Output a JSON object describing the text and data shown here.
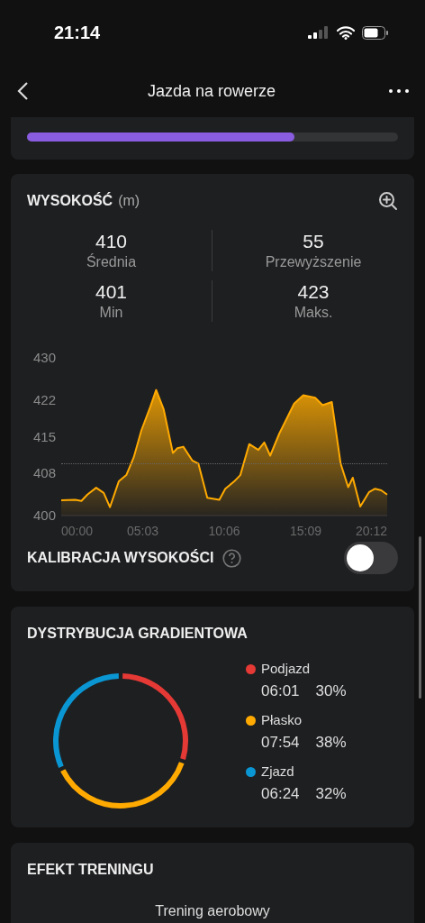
{
  "status_bar": {
    "time": "21:14"
  },
  "nav": {
    "title": "Jazda na rowerze"
  },
  "top_card": {
    "level": 0.72
  },
  "elevation": {
    "title": "WYSOKOŚĆ",
    "unit": "(m)",
    "stats": [
      {
        "value": "410",
        "label": "Średnia"
      },
      {
        "value": "55",
        "label": "Przewyższenie"
      },
      {
        "value": "401",
        "label": "Min"
      },
      {
        "value": "423",
        "label": "Maks."
      }
    ],
    "chart_data": {
      "type": "area",
      "x": [
        0,
        52,
        75,
        97,
        130,
        158,
        181,
        214,
        242,
        270,
        298,
        331,
        353,
        381,
        415,
        432,
        454,
        487,
        510,
        543,
        588,
        610,
        643,
        666,
        699,
        733,
        755,
        777,
        811,
        866,
        900,
        944,
        972,
        1006,
        1039,
        1067,
        1084,
        1112,
        1145,
        1167,
        1190,
        1212
      ],
      "series": [
        {
          "color": "#ffaa00",
          "values": [
            402.9,
            403.0,
            402.8,
            404.0,
            405.3,
            404.3,
            401.6,
            406.5,
            407.7,
            411.1,
            416.2,
            420.7,
            423.9,
            420.2,
            411.9,
            412.8,
            413.1,
            410.5,
            409.9,
            403.4,
            403.0,
            405.1,
            406.5,
            407.7,
            413.6,
            412.5,
            413.9,
            411.4,
            415.6,
            421.3,
            422.9,
            422.4,
            421.0,
            421.6,
            409.9,
            405.4,
            407.2,
            401.7,
            404.5,
            405.1,
            404.8,
            404.0
          ]
        }
      ],
      "xlim": [
        0,
        1212
      ],
      "ylim": [
        400,
        430
      ],
      "xticks": [
        {
          "value": 0,
          "label": "00:00"
        },
        {
          "value": 303,
          "label": "05:03"
        },
        {
          "value": 606,
          "label": "10:06"
        },
        {
          "value": 909,
          "label": "15:09"
        },
        {
          "value": 1212,
          "label": "20:12"
        }
      ],
      "yticks": [
        400,
        408,
        415,
        422,
        430
      ]
    },
    "calibration": {
      "label": "KALIBRACJA WYSOKOŚCI",
      "on": false
    }
  },
  "gradient": {
    "title": "DYSTRYBUCJA GRADIENTOWA",
    "items": [
      {
        "label": "Podjazd",
        "time": "06:01",
        "percent": "30%",
        "color": "#e53935"
      },
      {
        "label": "Płasko",
        "time": "07:54",
        "percent": "38%",
        "color": "#ffaa00"
      },
      {
        "label": "Zjazd",
        "time": "06:24",
        "percent": "32%",
        "color": "#0a96d2"
      }
    ]
  },
  "training": {
    "title": "EFEKT TRENINGU",
    "subtitle": "Trening aerobowy"
  }
}
